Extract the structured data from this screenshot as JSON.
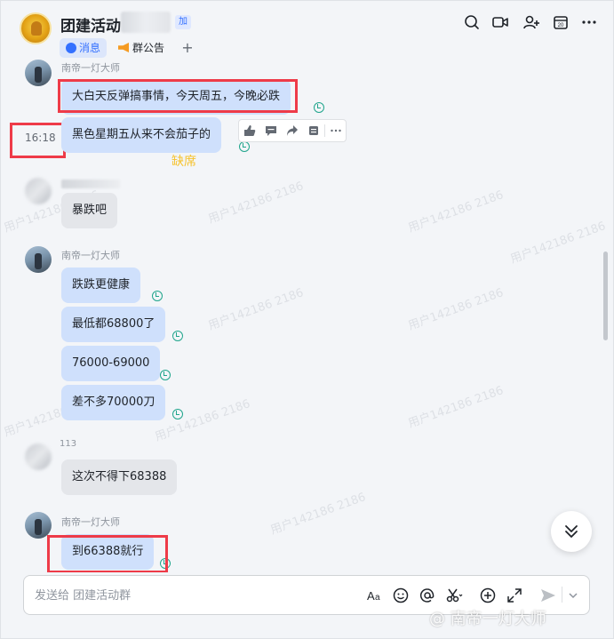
{
  "header": {
    "chat_title": "团建活动",
    "ext_tag": "加",
    "tabs": [
      {
        "label": "消息"
      },
      {
        "label": "群公告"
      },
      {
        "label": "+"
      }
    ],
    "icons": [
      "search-icon",
      "video-call-icon",
      "add-member-icon",
      "calendar-icon",
      "more-icon"
    ],
    "calendar_day": "20"
  },
  "watermark": {
    "text": "用户142186 2186"
  },
  "messages": [
    {
      "sender": "南帝一灯大师",
      "text": "大白天反弹搞事情，今天周五，今晚必跌"
    },
    {
      "time": "16:18",
      "text": "黑色星期五从来不会茄子的",
      "annotation": "缺席"
    },
    {
      "sender": "",
      "text": "暴跌吧"
    },
    {
      "sender": "南帝一灯大师",
      "texts": [
        "跌跌更健康",
        "最低都68800了",
        "76000-69000",
        "差不多70000刀"
      ]
    },
    {
      "sender": "113",
      "text": "这次不得下68388"
    },
    {
      "sender": "南帝一灯大师",
      "text": "到66388就行"
    }
  ],
  "composer": {
    "placeholder": "发送给 团建活动群",
    "icons": [
      "text-format-icon",
      "emoji-icon",
      "mention-icon",
      "screenshot-icon",
      "add-icon",
      "expand-icon",
      "send-icon",
      "chevron-down-icon"
    ]
  },
  "footer_watermark": "@ 南帝一灯大师",
  "colors": {
    "accent": "#3370ff",
    "own_bubble": "#cfe0fc",
    "other_bubble": "#e4e6ea",
    "highlight_box": "#ee3b48",
    "read_receipt": "#20a58c",
    "annotation": "#f6c22d"
  }
}
